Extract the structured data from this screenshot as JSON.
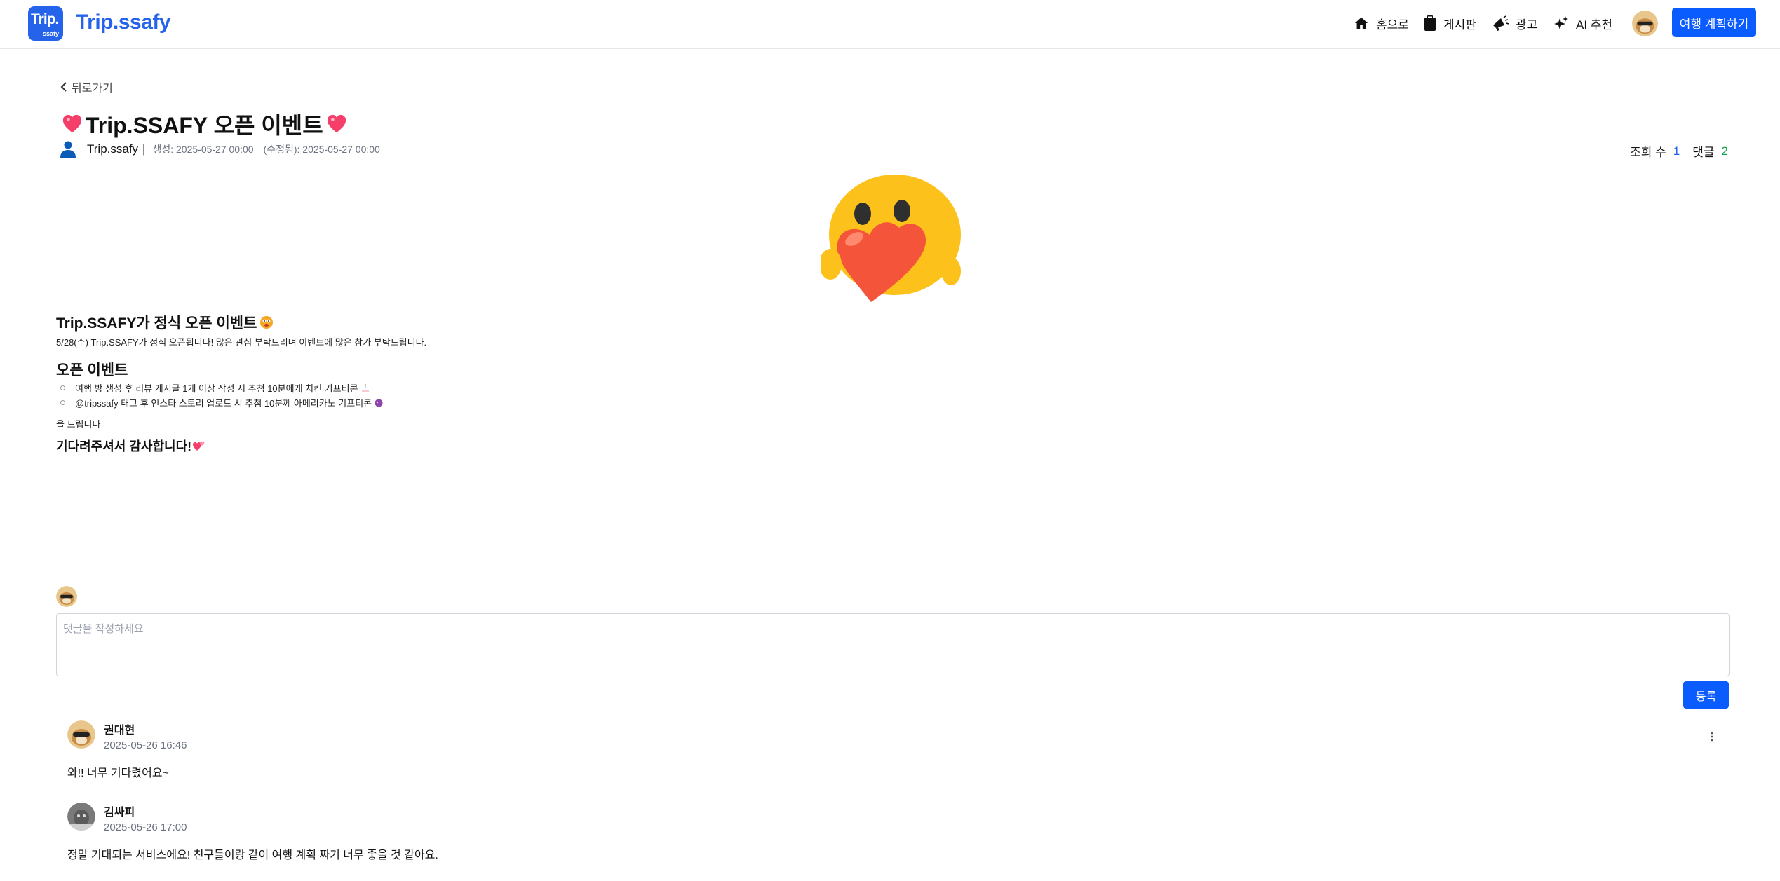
{
  "header": {
    "logo_top": "Trip.",
    "logo_bottom": "ssafy",
    "brand": "Trip.ssafy",
    "nav": [
      {
        "label": "홈으로",
        "icon": "home-icon"
      },
      {
        "label": "게시판",
        "icon": "clipboard-icon"
      },
      {
        "label": "광고",
        "icon": "megaphone-icon"
      },
      {
        "label": "AI 추천",
        "icon": "sparkles-icon"
      }
    ],
    "plan_button": "여행 계획하기",
    "brand_color": "#2563eb"
  },
  "post": {
    "back_label": "뒤로가기",
    "title": "Trip.SSAFY 오픈 이벤트",
    "author": "Trip.ssafy",
    "author_sep": "|",
    "created": "생성: 2025-05-27 00:00",
    "modified": "(수정됨): 2025-05-27 00:00",
    "views_label": "조회 수",
    "views": "1",
    "comments_label": "댓글",
    "comments": "2",
    "body": {
      "heading1": "Trip.SSAFY가 정식 오픈 이벤트",
      "para1": "5/28(수) Trip.SSAFY가 정식 오픈됩니다! 많은 관심 부탁드리며 이벤트에 많은 참가 부탁드립니다.",
      "heading2": "오픈 이벤트",
      "bullets": [
        "여행 방 생성 후 리뷰 게시글 1개 이상 작성 시 추첨 10분에게 치킨 기프티콘",
        "@tripssafy 태그 후 인스타 스토리 업로드 시 추첨 10분께 아메리카노 기프티콘"
      ],
      "para2": "을 드립니다",
      "closing": "기다려주셔서 감사합니다!"
    }
  },
  "comment_form": {
    "placeholder": "댓글을 작성하세요",
    "submit": "등록"
  },
  "comments": [
    {
      "name": "권대현",
      "date": "2025-05-26 16:46",
      "text": "와!! 너무 기다렸어요~"
    },
    {
      "name": "김싸피",
      "date": "2025-05-26 17:00",
      "text": "정말 기대되는 서비스에요! 친구들이랑 같이 여행 계획 짜기 너무 좋을 것 같아요."
    }
  ]
}
